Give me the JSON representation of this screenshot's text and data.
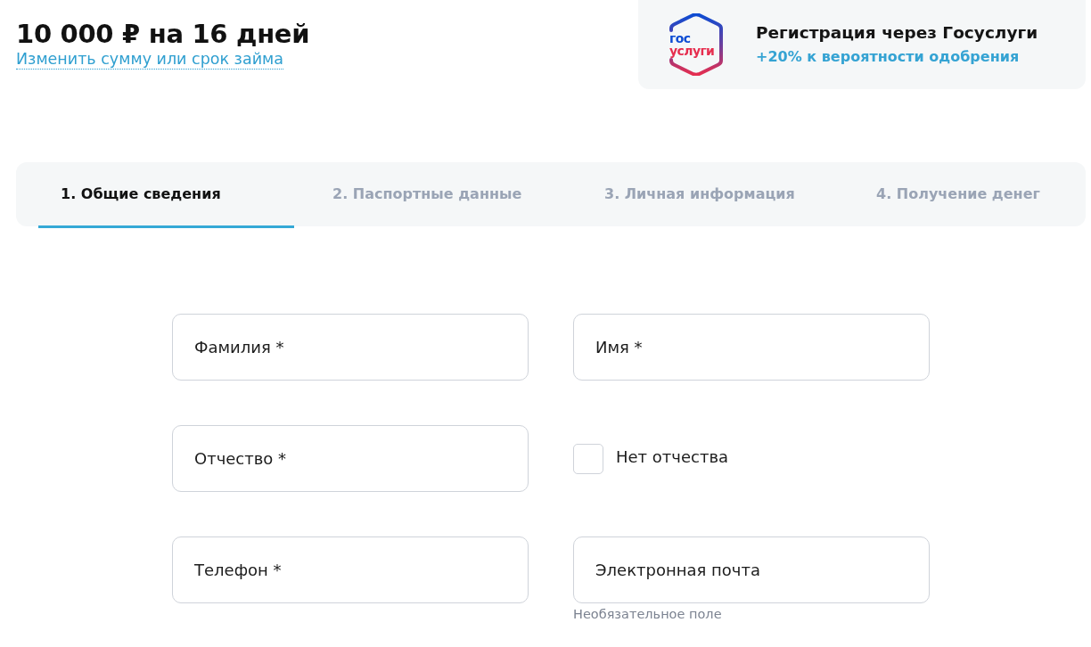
{
  "loan": {
    "title": "10 000 ₽ на 16 дней",
    "change_link": "Изменить сумму или срок займа"
  },
  "gosuslugi_banner": {
    "logo_lines": [
      "гос",
      "услуги"
    ],
    "title": "Регистрация через Госуслуги",
    "subtitle": "+20% к вероятности одобрения"
  },
  "tabs": [
    {
      "label": "1. Общие сведения",
      "selected": true
    },
    {
      "label": "2. Паспортные данные",
      "selected": false
    },
    {
      "label": "3. Личная информация",
      "selected": false
    },
    {
      "label": "4. Получение денег",
      "selected": false
    }
  ],
  "form": {
    "fields": [
      {
        "kind": "input",
        "placeholder": "Фамилия *"
      },
      {
        "kind": "input",
        "placeholder": "Имя *"
      },
      {
        "kind": "input",
        "placeholder": "Отчество *"
      },
      {
        "kind": "checkbox",
        "label": "Нет отчества",
        "checked": false
      },
      {
        "kind": "input",
        "placeholder": "Телефон *"
      },
      {
        "kind": "input",
        "placeholder": "Электронная почта",
        "helper": "Необязательное поле"
      }
    ]
  }
}
